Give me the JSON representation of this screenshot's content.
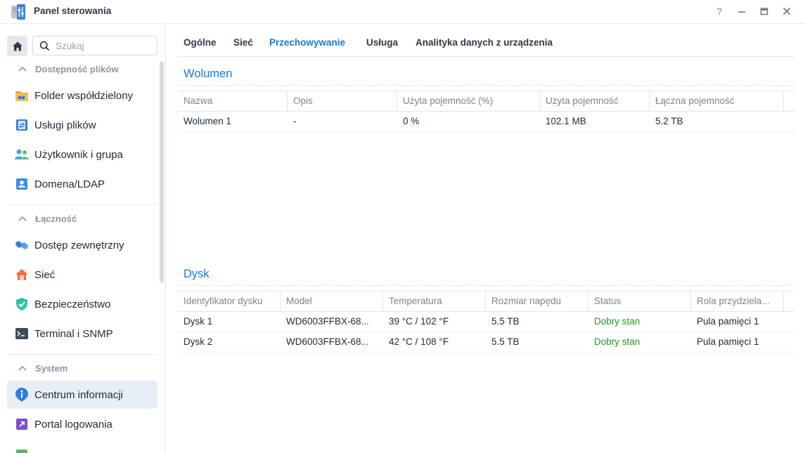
{
  "window": {
    "title": "Panel sterowania",
    "help_label": "?"
  },
  "sidebar": {
    "search_placeholder": "Szukaj",
    "sections": [
      {
        "title": "Dostępność plików",
        "items": [
          {
            "label": "Folder współdzielony",
            "icon": "shared-folder-icon"
          },
          {
            "label": "Usługi plików",
            "icon": "file-services-icon"
          },
          {
            "label": "Użytkownik i grupa",
            "icon": "user-group-icon"
          },
          {
            "label": "Domena/LDAP",
            "icon": "domain-ldap-icon"
          }
        ]
      },
      {
        "title": "Łączność",
        "items": [
          {
            "label": "Dostęp zewnętrzny",
            "icon": "external-access-icon"
          },
          {
            "label": "Sieć",
            "icon": "network-icon"
          },
          {
            "label": "Bezpieczeństwo",
            "icon": "security-icon"
          },
          {
            "label": "Terminal i SNMP",
            "icon": "terminal-icon"
          }
        ]
      },
      {
        "title": "System",
        "items": [
          {
            "label": "Centrum informacji",
            "icon": "info-center-icon",
            "active": true
          },
          {
            "label": "Portal logowania",
            "icon": "login-portal-icon"
          }
        ]
      }
    ]
  },
  "tabs": [
    "Ogólne",
    "Sieć",
    "Przechowywanie",
    "Usługa",
    "Analityka danych z urządzenia"
  ],
  "active_tab": "Przechowywanie",
  "volume": {
    "title": "Wolumen",
    "columns": [
      "Nazwa",
      "Opis",
      "Użyta pojemność (%)",
      "Użyta pojemność",
      "Łączna pojemność"
    ],
    "rows": [
      [
        "Wolumen 1",
        "-",
        "0 %",
        "102.1 MB",
        "5.2 TB"
      ]
    ]
  },
  "disk": {
    "title": "Dysk",
    "columns": [
      "Identyfikator dysku",
      "Model",
      "Temperatura",
      "Rozmiar napędu",
      "Status",
      "Rola przydziela..."
    ],
    "rows": [
      [
        "Dysk 1",
        "WD6003FFBX-68...",
        "39 °C / 102 °F",
        "5.5 TB",
        "Dobry stan",
        "Pula pamięci 1"
      ],
      [
        "Dysk 2",
        "WD6003FFBX-68...",
        "42 °C / 108 °F",
        "5.5 TB",
        "Dobry stan",
        "Pula pamięci 1"
      ]
    ]
  },
  "colors": {
    "accent": "#1e78c8",
    "status_good": "#1e9a1e"
  }
}
